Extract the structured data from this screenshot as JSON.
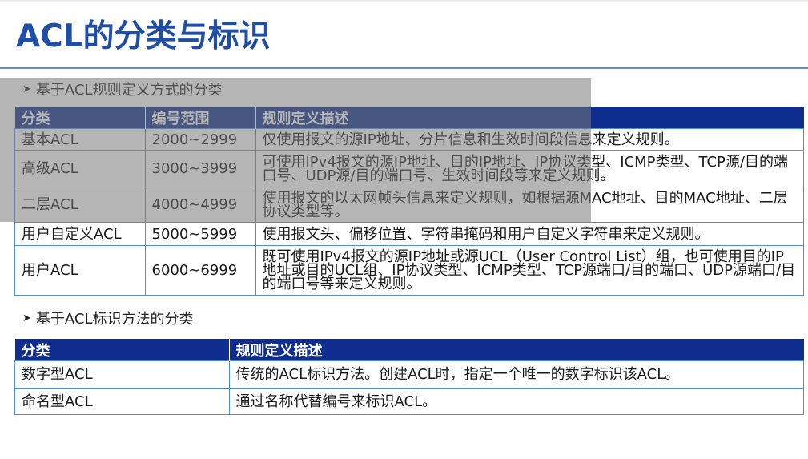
{
  "title": "ACL的分类与标识",
  "section1": {
    "heading": "基于ACL规则定义方式的分类",
    "headers": [
      "分类",
      "编号范围",
      "规则定义描述"
    ],
    "rows": [
      {
        "category": "基本ACL",
        "range": "2000~2999",
        "desc": "仅使用报文的源IP地址、分片信息和生效时间段信息来定义规则。"
      },
      {
        "category": "高级ACL",
        "range": "3000~3999",
        "desc": "可使用IPv4报文的源IP地址、目的IP地址、IP协议类型、ICMP类型、TCP源/目的端口号、UDP源/目的端口号、生效时间段等来定义规则。"
      },
      {
        "category": "二层ACL",
        "range": "4000~4999",
        "desc": "使用报文的以太网帧头信息来定义规则，如根据源MAC地址、目的MAC地址、二层协议类型等。"
      },
      {
        "category": "用户自定义ACL",
        "range": "5000~5999",
        "desc": "使用报文头、偏移位置、字符串掩码和用户自定义字符串来定义规则。"
      },
      {
        "category": "用户ACL",
        "range": "6000~6999",
        "desc": "既可使用IPv4报文的源IP地址或源UCL（User Control List）组，也可使用目的IP地址或目的UCL组、IP协议类型、ICMP类型、TCP源端口/目的端口、UDP源端口/目的端口号等来定义规则。"
      }
    ]
  },
  "section2": {
    "heading": "基于ACL标识方法的分类",
    "headers": [
      "分类",
      "规则定义描述"
    ],
    "rows": [
      {
        "category": "数字型ACL",
        "desc": "传统的ACL标识方法。创建ACL时，指定一个唯一的数字标识该ACL。"
      },
      {
        "category": "命名型ACL",
        "desc": "通过名称代替编号来标识ACL。"
      }
    ]
  },
  "colors": {
    "title": "#1f4ea8",
    "header_bg": "#0f2d8f",
    "border": "#4b8fd9"
  }
}
